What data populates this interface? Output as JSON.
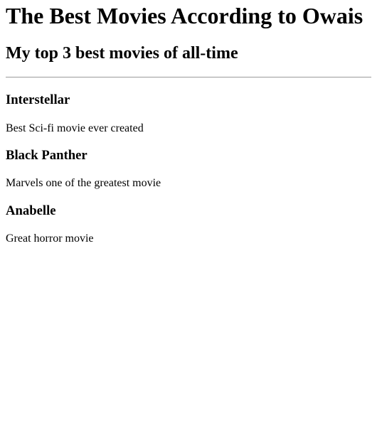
{
  "page": {
    "title": "The Best Movies According to Owais",
    "subtitle": "My top 3 best movies of all-time"
  },
  "movies": [
    {
      "title": "Interstellar",
      "description": "Best Sci-fi movie ever created"
    },
    {
      "title": "Black Panther",
      "description": "Marvels one of the greatest movie"
    },
    {
      "title": "Anabelle",
      "description": "Great horror movie"
    }
  ]
}
